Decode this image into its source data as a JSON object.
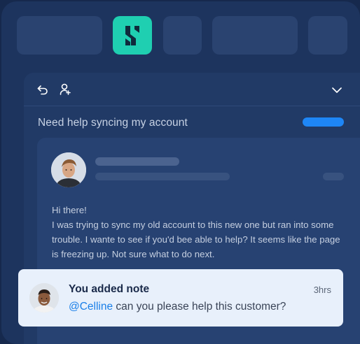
{
  "toolbar": {
    "icons": [
      "undo-icon",
      "user-add-icon",
      "chevron-down-icon"
    ]
  },
  "logo": {
    "icon": "brand-logo-icon",
    "color": "#1fcfb1"
  },
  "ticket": {
    "subject": "Need help syncing my account",
    "status_color": "#1e86f6",
    "message": {
      "greeting": "Hi there!",
      "body": "I was trying to sync my old account to this new one but ran into some trouble. I wante to see if you'd bee able to help? It seems like the page is freezing up. Not sure what to do next."
    }
  },
  "note": {
    "title": "You added note",
    "time": "3hrs",
    "mention": "@Celline",
    "text": " can you please help this customer?"
  }
}
